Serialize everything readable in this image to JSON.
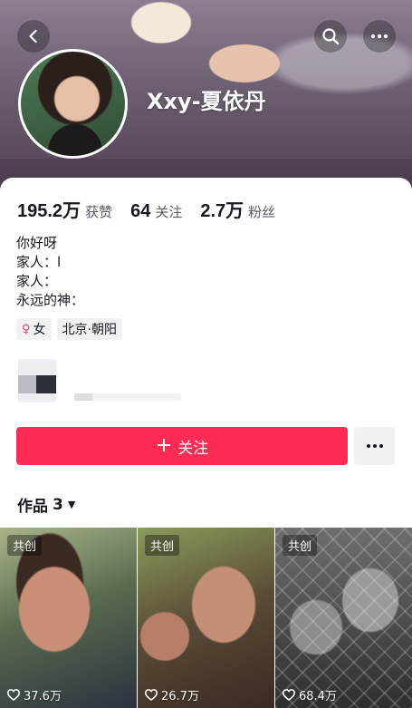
{
  "profile": {
    "nickname": "Xxy-夏依丹"
  },
  "stats": [
    {
      "num": "195.2万",
      "label": "获赞"
    },
    {
      "num": "64",
      "label": "关注"
    },
    {
      "num": "2.7万",
      "label": "粉丝"
    }
  ],
  "bio": [
    "你好呀",
    "家人：l",
    "家人：",
    "永远的神："
  ],
  "tags": [
    {
      "icon": "female-icon",
      "label": "女"
    },
    {
      "label": "北京·朝阳"
    }
  ],
  "actions": {
    "follow_label": "关注",
    "follow_plus": "+"
  },
  "works": {
    "label": "作品",
    "count": "3"
  },
  "videos": [
    {
      "badge": "共创",
      "likes": "37.6万"
    },
    {
      "badge": "共创",
      "likes": "26.7万"
    },
    {
      "badge": "共创",
      "likes": "68.4万"
    }
  ],
  "colors": {
    "accent": "#fe2c55",
    "female_tag": "#e8407a"
  }
}
